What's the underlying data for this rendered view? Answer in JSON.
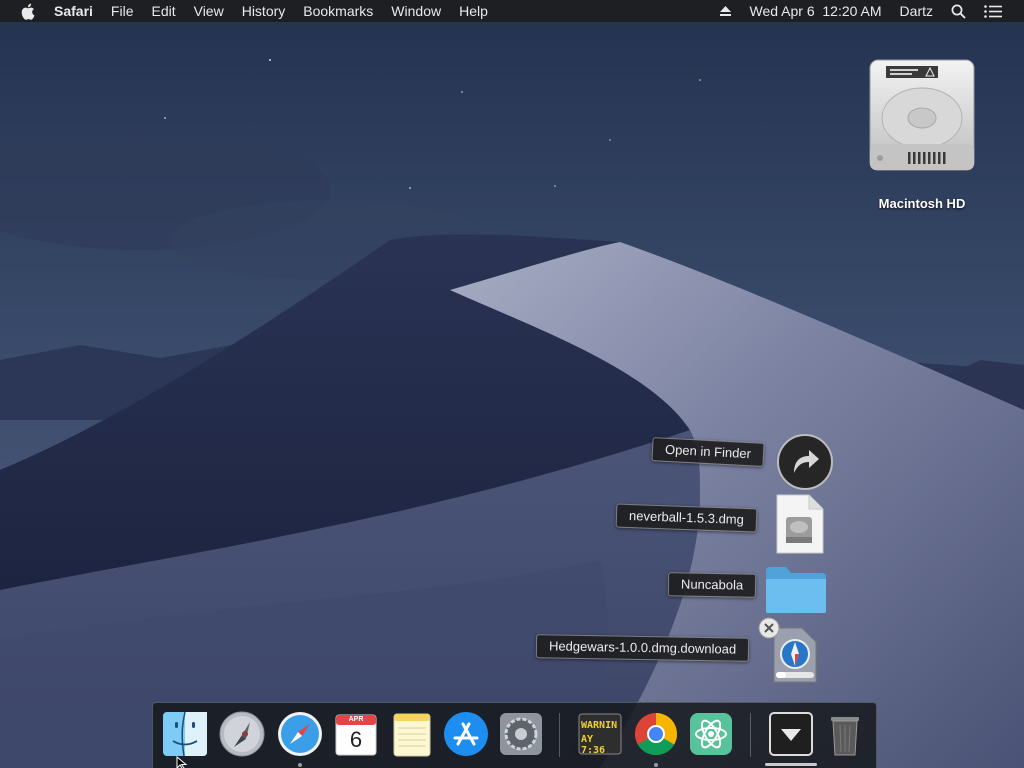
{
  "menubar": {
    "apple_icon": "apple-logo-icon",
    "app_name": "Safari",
    "menus": [
      "File",
      "Edit",
      "View",
      "History",
      "Bookmarks",
      "Window",
      "Help"
    ],
    "eject_icon": "eject-icon",
    "clock": "Wed Apr 6  12:20 AM",
    "user": "Dartz",
    "search_icon": "spotlight-search-icon",
    "notification_icon": "notification-center-icon"
  },
  "desktop": {
    "drive_label": "Macintosh HD"
  },
  "downloads_fan": {
    "open_in_finder": "Open in Finder",
    "items": [
      {
        "label": "neverball-1.5.3.dmg",
        "icon": "disk-image-icon"
      },
      {
        "label": "Nuncabola",
        "icon": "folder-icon"
      },
      {
        "label": "Hedgewars-1.0.0.dmg.download",
        "icon": "download-in-progress-icon"
      }
    ]
  },
  "dock": {
    "calendar_month": "APR",
    "calendar_day": "6",
    "console_text_1": "WARNIN",
    "console_text_2": "AY 7:36",
    "apps": [
      "Finder",
      "Launchpad",
      "Safari",
      "Calendar",
      "Notes",
      "App Store",
      "System Preferences",
      "Console",
      "Google Chrome",
      "Atom",
      "Downloads",
      "Trash"
    ]
  },
  "colors": {
    "menubar_bg": "#1d1f22",
    "folder_blue": "#5fb4e8",
    "dock_bg": "#14161a"
  }
}
